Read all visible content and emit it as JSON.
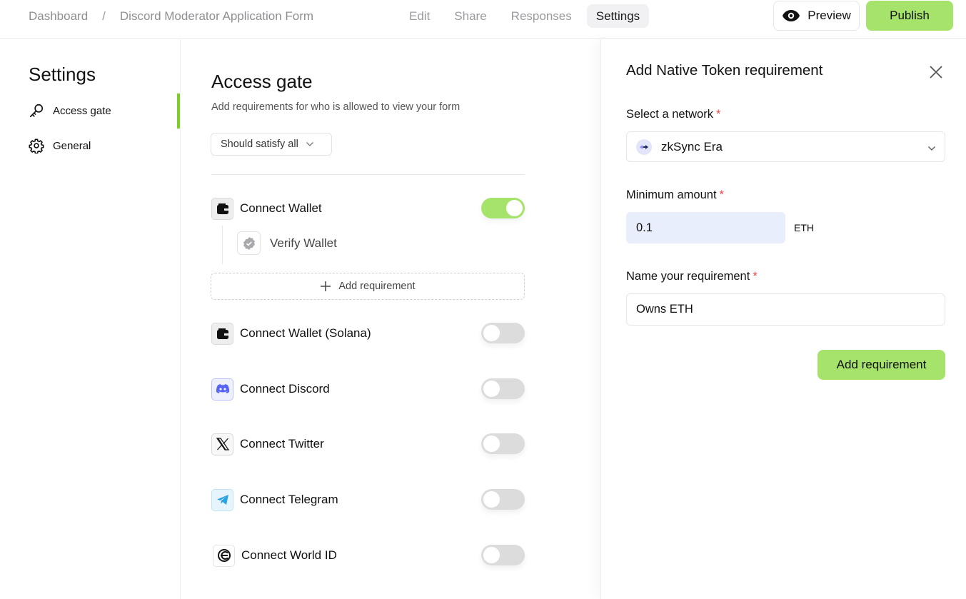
{
  "header": {
    "breadcrumb": {
      "root": "Dashboard",
      "separator": "/",
      "current": "Discord Moderator Application Form"
    },
    "tabs": [
      {
        "label": "Edit",
        "active": false
      },
      {
        "label": "Share",
        "active": false
      },
      {
        "label": "Responses",
        "active": false
      },
      {
        "label": "Settings",
        "active": true
      }
    ],
    "preview_label": "Preview",
    "publish_label": "Publish"
  },
  "sidebar": {
    "title": "Settings",
    "items": [
      {
        "label": "Access gate",
        "icon": "key-icon",
        "active": true
      },
      {
        "label": "General",
        "icon": "gear-icon",
        "active": false
      }
    ]
  },
  "main": {
    "title": "Access gate",
    "subtitle": "Add requirements for who is allowed to view your form",
    "satisfy_select": "Should satisfy all",
    "requirements": [
      {
        "label": "Connect Wallet",
        "icon": "wallet-icon",
        "enabled": true,
        "sub_items": [
          {
            "label": "Verify Wallet",
            "icon": "verified-badge-icon"
          }
        ]
      },
      {
        "label": "Connect Wallet (Solana)",
        "icon": "wallet-icon",
        "enabled": false
      },
      {
        "label": "Connect Discord",
        "icon": "discord-icon",
        "enabled": false
      },
      {
        "label": "Connect Twitter",
        "icon": "x-twitter-icon",
        "enabled": false
      },
      {
        "label": "Connect Telegram",
        "icon": "telegram-icon",
        "enabled": false
      },
      {
        "label": "Connect World ID",
        "icon": "worldcoin-icon",
        "enabled": false
      }
    ],
    "add_requirement_label": "Add requirement"
  },
  "panel": {
    "title": "Add Native Token requirement",
    "network_label": "Select a network",
    "required_mark": "*",
    "network_value": "zkSync Era",
    "amount_label": "Minimum amount",
    "amount_value": "0.1",
    "amount_unit": "ETH",
    "name_label": "Name your requirement",
    "name_value": "Owns ETH",
    "submit_label": "Add requirement"
  },
  "colors": {
    "accent_green": "#a6e36a",
    "indicator_green": "#7ccc2c",
    "required_red": "#ef4444",
    "amount_input_bg": "#e8eefb"
  }
}
